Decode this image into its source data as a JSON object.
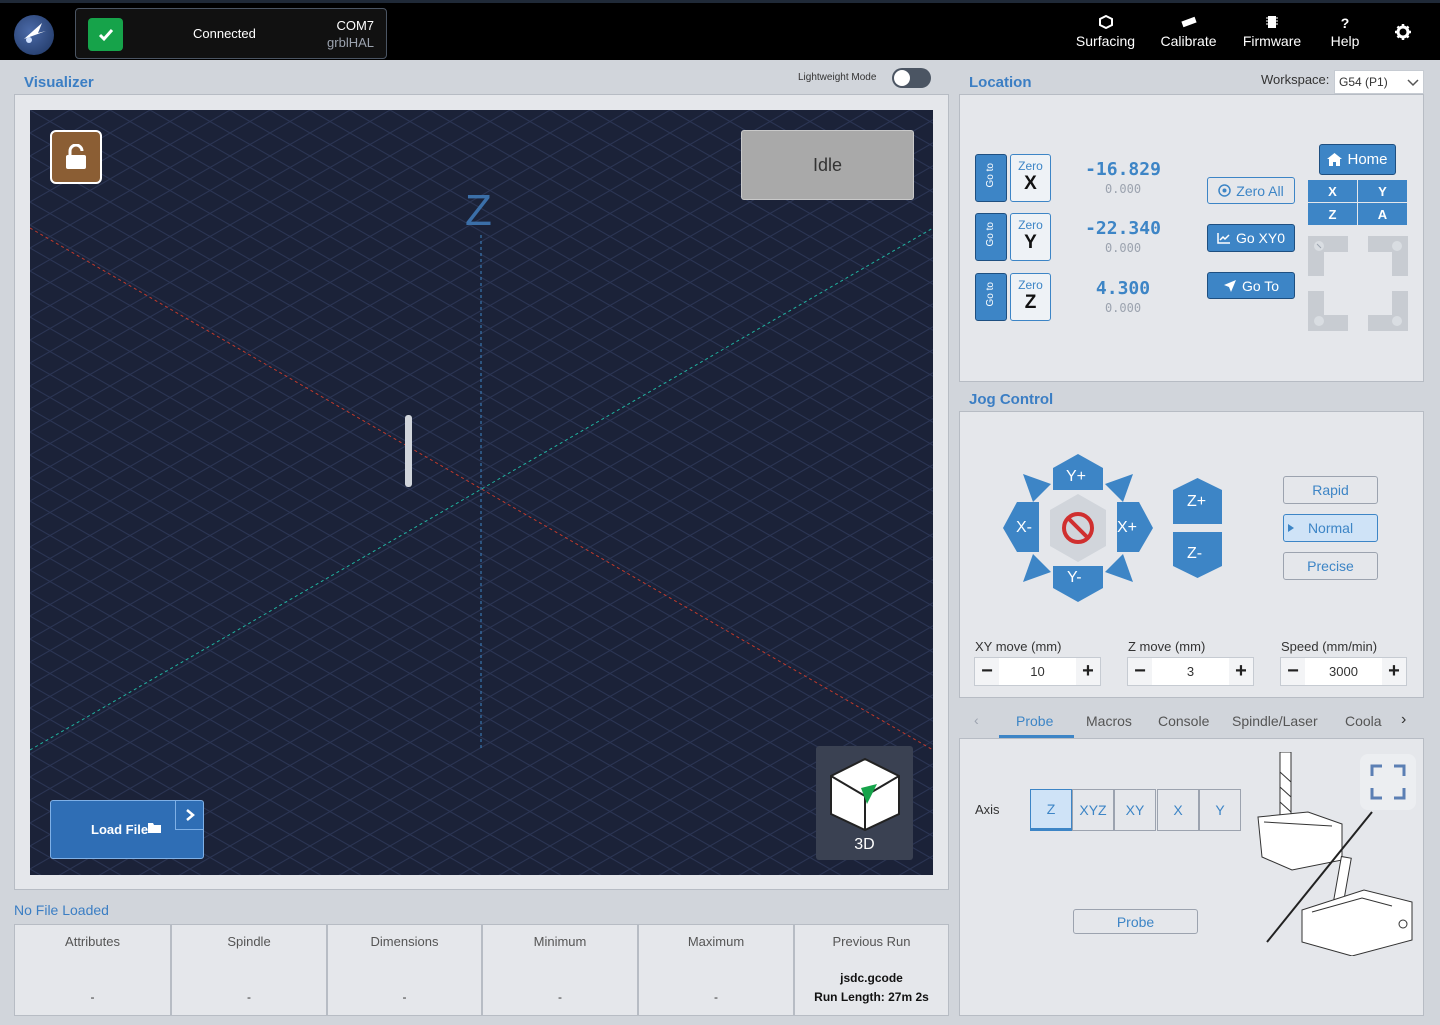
{
  "header": {
    "connection": {
      "status": "Connected",
      "port": "COM7",
      "firmware": "grblHAL"
    },
    "nav": [
      {
        "label": "Surfacing",
        "icon": "surfacing-icon"
      },
      {
        "label": "Calibrate",
        "icon": "calibrate-icon"
      },
      {
        "label": "Firmware",
        "icon": "firmware-icon"
      },
      {
        "label": "Help",
        "icon": "help-icon"
      }
    ]
  },
  "visualizer": {
    "title": "Visualizer",
    "lightweight_label": "Lightweight Mode",
    "lightweight_on": false,
    "state": "Idle",
    "z_label": "Z",
    "load_file": "Load File",
    "view_label": "3D"
  },
  "location": {
    "title": "Location",
    "workspace_label": "Workspace:",
    "workspace_value": "G54 (P1)",
    "go_label": "Go to",
    "zero_label": "Zero",
    "axes": [
      {
        "axis": "X",
        "machine": "-16.829",
        "work": "0.000"
      },
      {
        "axis": "Y",
        "machine": "-22.340",
        "work": "0.000"
      },
      {
        "axis": "Z",
        "machine": "4.300",
        "work": "0.000"
      }
    ],
    "zero_all": "Zero All",
    "go_xy0": "Go XY0",
    "go_to": "Go To",
    "home": "Home",
    "home_axes": [
      "X",
      "Y",
      "Z",
      "A"
    ]
  },
  "jog": {
    "title": "Jog Control",
    "buttons": {
      "yplus": "Y+",
      "yminus": "Y-",
      "xplus": "X+",
      "xminus": "X-",
      "zplus": "Z+",
      "zminus": "Z-"
    },
    "modes": [
      "Rapid",
      "Normal",
      "Precise"
    ],
    "active_mode": "Normal",
    "xy_label": "XY move (mm)",
    "xy_value": "10",
    "z_label": "Z move (mm)",
    "z_value": "3",
    "speed_label": "Speed (mm/min)",
    "speed_value": "3000"
  },
  "tabs": {
    "items": [
      "Probe",
      "Macros",
      "Console",
      "Spindle/Laser",
      "Coola"
    ],
    "active": "Probe"
  },
  "probe": {
    "axis_label": "Axis",
    "axes": [
      "Z",
      "XYZ",
      "XY",
      "X",
      "Y"
    ],
    "active_axis": "Z",
    "probe_button": "Probe"
  },
  "file": {
    "status": "No File Loaded",
    "columns": [
      {
        "header": "Attributes",
        "value": "-"
      },
      {
        "header": "Spindle",
        "value": "-"
      },
      {
        "header": "Dimensions",
        "value": "-"
      },
      {
        "header": "Minimum",
        "value": "-"
      },
      {
        "header": "Maximum",
        "value": "-"
      }
    ],
    "previous_run": {
      "header": "Previous Run",
      "filename": "jsdc.gcode",
      "run_length": "Run Length: 27m 2s"
    }
  }
}
